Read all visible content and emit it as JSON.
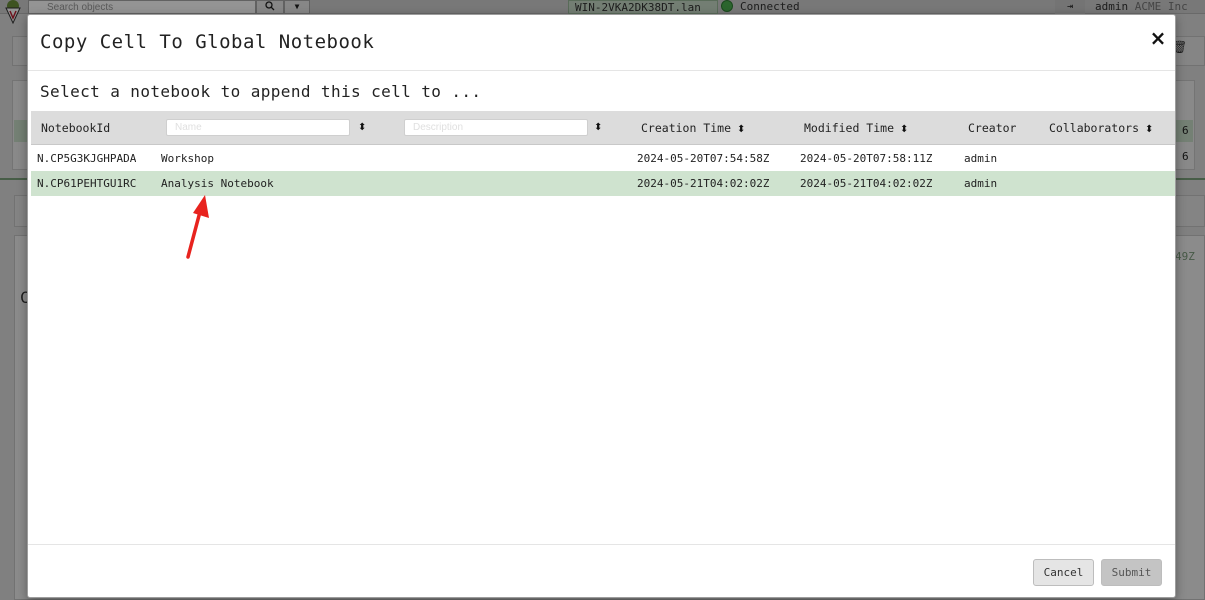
{
  "background": {
    "search_placeholder": "Search objects",
    "server": "WIN-2VKA2DK38DT.lan",
    "status": "Connected",
    "user": "admin",
    "org": "ACME Inc",
    "count_a": "6",
    "count_b": "6",
    "time_fragment": "49Z",
    "letter": "C"
  },
  "modal": {
    "title": "Copy Cell To Global Notebook",
    "close_label": "×",
    "instruction": "Select a notebook to append this cell to ...",
    "columns": {
      "notebook_id": "NotebookId",
      "name_placeholder": "Name",
      "description_placeholder": "Description",
      "creation_time": "Creation Time",
      "modified_time": "Modified Time",
      "creator": "Creator",
      "collaborators": "Collaborators"
    },
    "rows": [
      {
        "id": "N.CP5G3KJGHPADA",
        "name": "Workshop",
        "description": "",
        "created": "2024-05-20T07:54:58Z",
        "modified": "2024-05-20T07:58:11Z",
        "creator": "admin",
        "collaborators": ""
      },
      {
        "id": "N.CP61PEHTGU1RC",
        "name": "Analysis Notebook",
        "description": "",
        "created": "2024-05-21T04:02:02Z",
        "modified": "2024-05-21T04:02:02Z",
        "creator": "admin",
        "collaborators": ""
      }
    ],
    "selected_row": 1,
    "buttons": {
      "cancel": "Cancel",
      "submit": "Submit"
    }
  },
  "colors": {
    "selected_row": "#cfe3cf",
    "header": "#dcdcdc",
    "annotation_arrow": "#e8231e"
  }
}
